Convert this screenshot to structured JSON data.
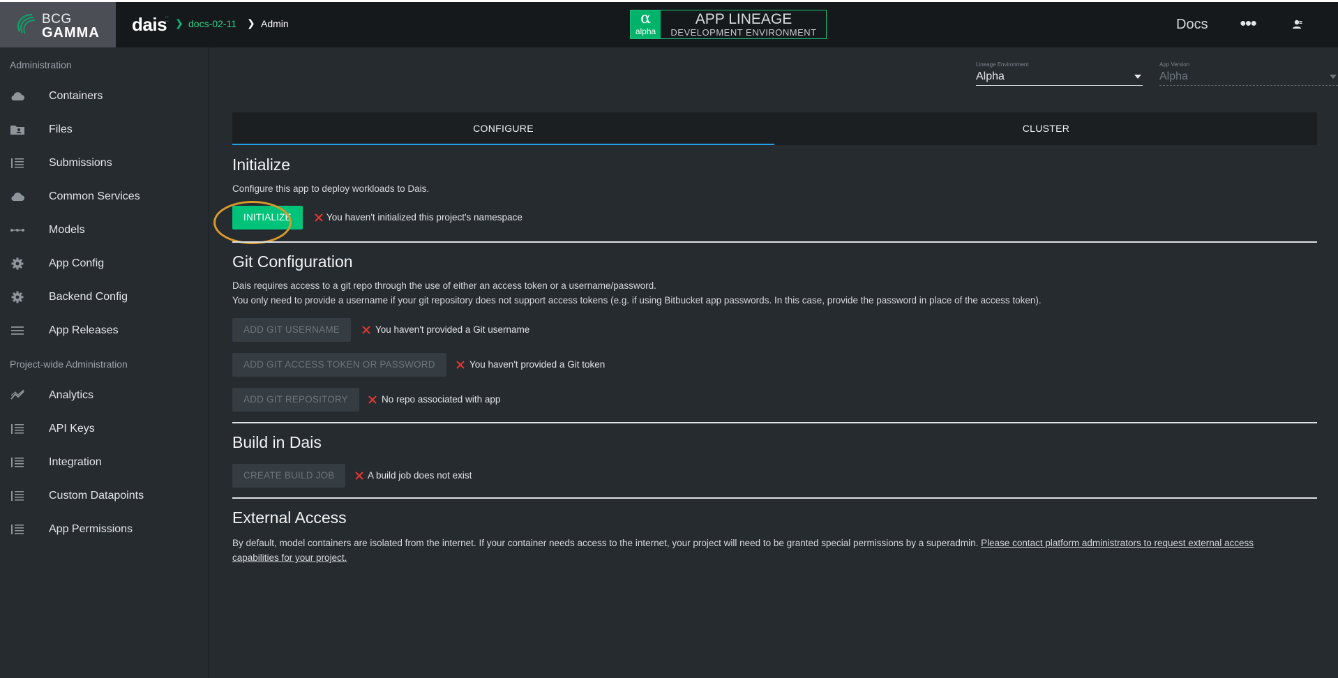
{
  "header": {
    "logo_top": "BCG",
    "logo_bottom": "GAMMA",
    "brand": "dais",
    "breadcrumb": {
      "project": "docs-02-11",
      "page": "Admin"
    },
    "env_badge": {
      "symbol": "α",
      "word": "alpha",
      "title": "APP LINEAGE",
      "subtitle": "DEVELOPMENT ENVIRONMENT"
    },
    "docs_label": "Docs",
    "more_icon": "●●●"
  },
  "sidebar": {
    "section1": "Administration",
    "section2": "Project-wide Administration",
    "items": [
      {
        "label": "Containers",
        "icon": "cloud-icon"
      },
      {
        "label": "Files",
        "icon": "folder-icon"
      },
      {
        "label": "Submissions",
        "icon": "list-icon"
      },
      {
        "label": "Common Services",
        "icon": "cloud-icon"
      },
      {
        "label": "Models",
        "icon": "dots-icon"
      },
      {
        "label": "App Config",
        "icon": "gear-icon"
      },
      {
        "label": "Backend Config",
        "icon": "gear-icon"
      },
      {
        "label": "App Releases",
        "icon": "menu-icon"
      }
    ],
    "items2": [
      {
        "label": "Analytics",
        "icon": "trend-icon"
      },
      {
        "label": "API Keys",
        "icon": "list-icon"
      },
      {
        "label": "Integration",
        "icon": "list-icon"
      },
      {
        "label": "Custom Datapoints",
        "icon": "list-icon"
      },
      {
        "label": "App Permissions",
        "icon": "list-icon"
      }
    ]
  },
  "selectors": {
    "lineage": {
      "label": "Lineage Environment",
      "value": "Alpha"
    },
    "version": {
      "label": "App Version",
      "value": "Alpha"
    }
  },
  "tabs": [
    {
      "label": "CONFIGURE",
      "active": true
    },
    {
      "label": "CLUSTER",
      "active": false
    }
  ],
  "initialize": {
    "title": "Initialize",
    "description": "Configure this app to deploy workloads to Dais.",
    "button": "INITIALIZE",
    "status": "You haven't initialized this project's namespace"
  },
  "git": {
    "title": "Git Configuration",
    "line1": "Dais requires access to a git repo through the use of either an access token or a username/password.",
    "line2": "You only need to provide a username if your git repository does not support access tokens (e.g. if using Bitbucket app passwords. In this case, provide the password in place of the access token).",
    "username_button": "ADD GIT USERNAME",
    "username_status": "You haven't provided a Git username",
    "token_button": "ADD GIT ACCESS TOKEN OR PASSWORD",
    "token_status": "You haven't provided a Git token",
    "repo_button": "ADD GIT REPOSITORY",
    "repo_status": "No repo associated with app"
  },
  "build": {
    "title": "Build in Dais",
    "button": "CREATE BUILD JOB",
    "status": "A build job does not exist"
  },
  "external": {
    "title": "External Access",
    "text": "By default, model containers are isolated from the internet. If your container needs access to the internet, your project will need to be granted special permissions by a superadmin. ",
    "link_part1": "Please contact platform administrators to request external access",
    "link_part2": "capabilities for your project."
  },
  "colors": {
    "accent": "#00c37a",
    "error": "#e8372f",
    "highlight_ring": "#d89b2b",
    "tab_indicator": "#1fa3e8"
  }
}
